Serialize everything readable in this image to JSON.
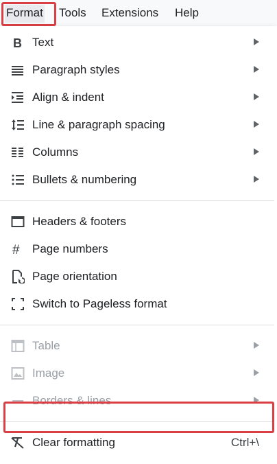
{
  "menubar": {
    "items": [
      {
        "label": "Format"
      },
      {
        "label": "Tools"
      },
      {
        "label": "Extensions"
      },
      {
        "label": "Help"
      }
    ]
  },
  "format_menu": {
    "group1": [
      {
        "label": "Text",
        "icon": "bold-icon",
        "submenu": true
      },
      {
        "label": "Paragraph styles",
        "icon": "paragraph-styles-icon",
        "submenu": true
      },
      {
        "label": "Align & indent",
        "icon": "align-indent-icon",
        "submenu": true
      },
      {
        "label": "Line & paragraph spacing",
        "icon": "line-spacing-icon",
        "submenu": true
      },
      {
        "label": "Columns",
        "icon": "columns-icon",
        "submenu": true
      },
      {
        "label": "Bullets & numbering",
        "icon": "bulleted-list-icon",
        "submenu": true
      }
    ],
    "group2": [
      {
        "label": "Headers & footers",
        "icon": "headers-footers-icon"
      },
      {
        "label": "Page numbers",
        "icon": "hash-icon"
      },
      {
        "label": "Page orientation",
        "icon": "page-orientation-icon"
      },
      {
        "label": "Switch to Pageless format",
        "icon": "pageless-icon"
      }
    ],
    "group3": [
      {
        "label": "Table",
        "icon": "table-icon",
        "submenu": true,
        "disabled": true
      },
      {
        "label": "Image",
        "icon": "image-icon",
        "submenu": true,
        "disabled": true
      },
      {
        "label": "Borders & lines",
        "icon": "borders-lines-icon",
        "submenu": true,
        "disabled": true
      }
    ],
    "clear_formatting": {
      "label": "Clear formatting",
      "shortcut": "Ctrl+\\",
      "icon": "clear-formatting-icon"
    }
  },
  "colors": {
    "highlight_border": "#d93f44",
    "disabled_text": "#9aa0a6",
    "text": "#202124"
  }
}
